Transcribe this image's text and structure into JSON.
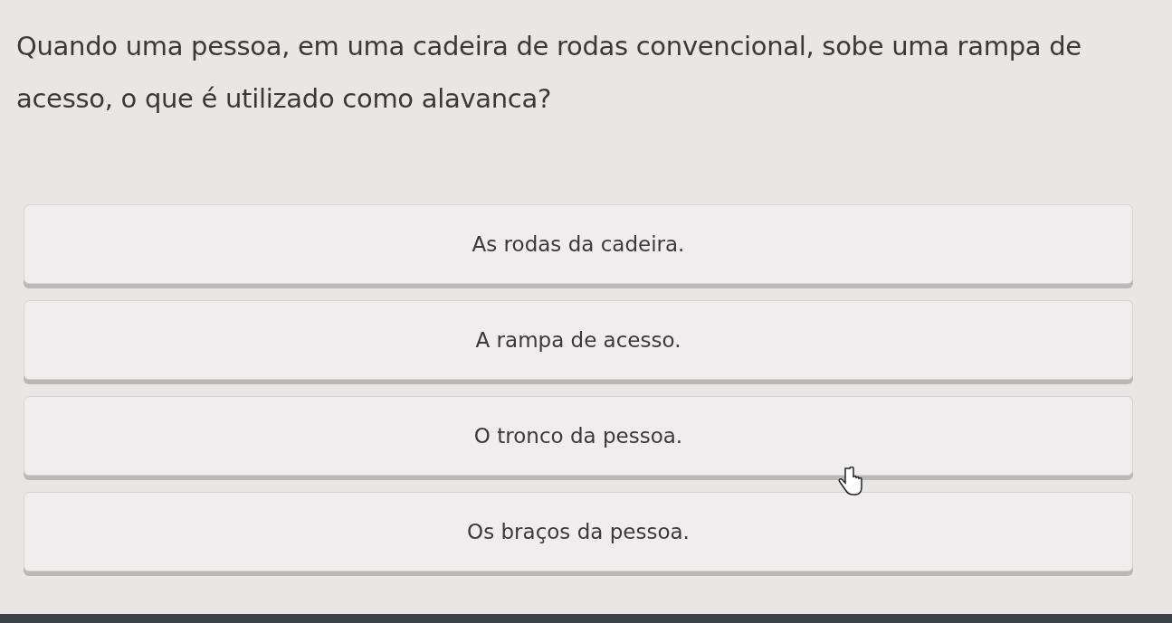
{
  "question": "Quando uma pessoa, em uma cadeira de rodas convencional, sobe uma rampa de acesso, o que é utilizado como alavanca?",
  "options": [
    {
      "label": "As rodas da cadeira."
    },
    {
      "label": "A rampa de acesso."
    },
    {
      "label": "O tronco da pessoa."
    },
    {
      "label": "Os braços da pessoa."
    }
  ]
}
